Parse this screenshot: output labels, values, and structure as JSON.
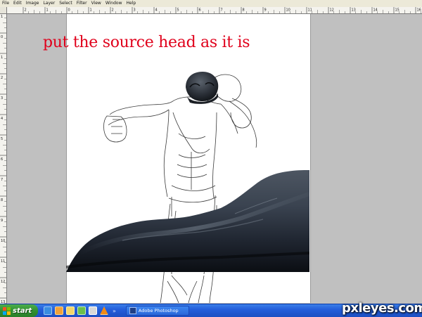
{
  "menubar": {
    "items": [
      "File",
      "Edit",
      "Image",
      "Layer",
      "Select",
      "Filter",
      "View",
      "Window",
      "Help"
    ]
  },
  "rulers": {
    "top_labels": [
      "2",
      "1",
      "0",
      "1",
      "2",
      "3",
      "4",
      "5",
      "6",
      "7",
      "8",
      "9",
      "10",
      "11",
      "12",
      "13",
      "14",
      "15",
      "16"
    ],
    "left_labels": [
      "1",
      "0",
      "1",
      "2",
      "3",
      "4",
      "5",
      "6",
      "7",
      "8",
      "9",
      "10",
      "11",
      "12",
      "13"
    ]
  },
  "canvas": {
    "caption": "put the source head as it is",
    "caption_color": "#e0001b"
  },
  "taskbar": {
    "start_label": "start",
    "overflow_label": "»",
    "task_button_label": "Adobe Photoshop",
    "quicklaunch_icons": [
      "ie-icon",
      "media-icon",
      "folder-icon",
      "program-icon",
      "app-icon",
      "vlc-icon"
    ]
  },
  "watermark": {
    "text": "pxleyes.com"
  },
  "colors": {
    "workspace": "#c0c0c0",
    "canvas": "#ffffff",
    "taskbar": "#245edb",
    "start_button": "#2f8e2f"
  }
}
